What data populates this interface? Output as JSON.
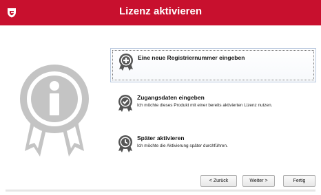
{
  "window": {
    "title": "Lizenz aktivieren",
    "title_color": "#c8102e",
    "logo_icon": "shield-icon"
  },
  "badge": {
    "icon": "info-badge-icon",
    "color": "#c4c4c4"
  },
  "options": [
    {
      "title": "Eine neue Registriernummer eingeben",
      "description": "",
      "icon": "plus-badge-icon",
      "selected": true
    },
    {
      "title": "Zugangsdaten eingeben",
      "description": "Ich möchte dieses Produkt mit einer bereits aktivierten Lizenz nutzen.",
      "icon": "check-badge-icon",
      "selected": false
    },
    {
      "title": "Später aktivieren",
      "description": "Ich möchte die Aktivierung später durchführen.",
      "icon": "clock-badge-icon",
      "selected": false
    }
  ],
  "buttons": {
    "back": "< Zurück",
    "next": "Weiter >",
    "finish": "Fertig"
  }
}
